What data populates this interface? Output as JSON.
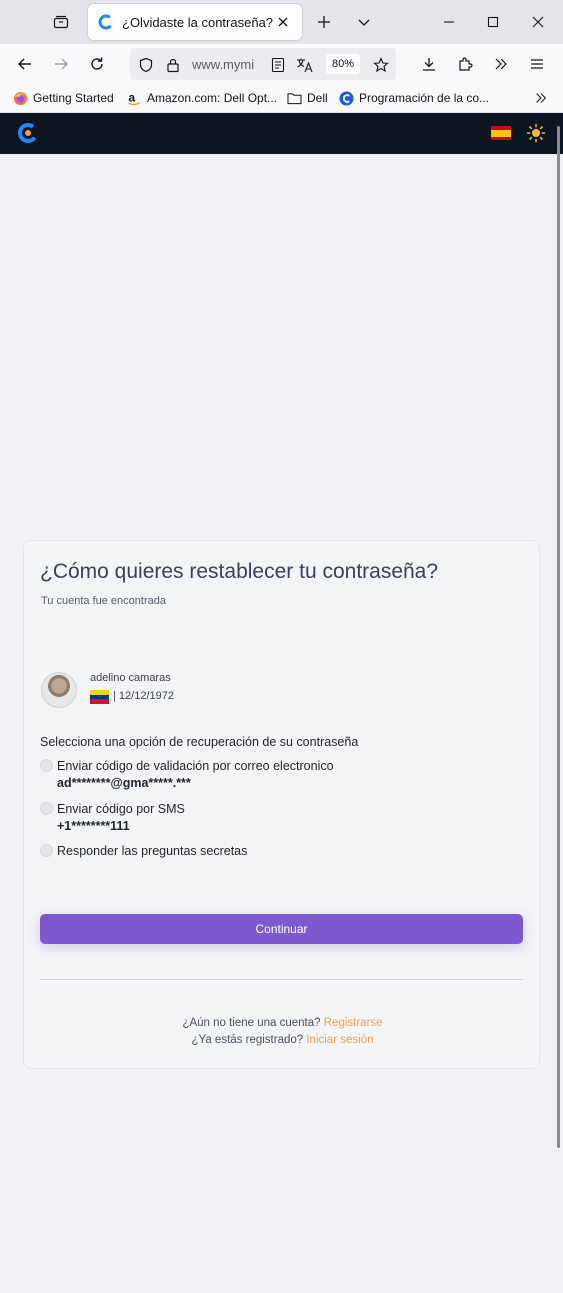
{
  "browser": {
    "tab_title": "¿Olvidaste la contraseña?",
    "url_text": "www.mymi",
    "zoom": "80%",
    "bookmarks": [
      {
        "label": "Getting Started",
        "icon": "firefox-icon"
      },
      {
        "label": "Amazon.com: Dell Opt...",
        "icon": "amazon-icon"
      },
      {
        "label": "Dell",
        "icon": "folder-icon"
      },
      {
        "label": "Programación de la co...",
        "icon": "site-c-icon"
      }
    ]
  },
  "site": {
    "brand_color": "#1e88ff",
    "header_bg": "#0d1523"
  },
  "card": {
    "title": "¿Cómo quieres restablecer tu contraseña?",
    "subtitle": "Tu cuenta fue encontrada",
    "user": {
      "name": "adelino camaras",
      "date": "| 12/12/1972"
    },
    "options_heading": "Selecciona una opción de recuperación de su contraseña",
    "options": [
      {
        "label": "Enviar código de validación por correo electronico",
        "detail": "ad********@gma*****.***"
      },
      {
        "label": "Enviar código por SMS",
        "detail": "+1********111"
      },
      {
        "label": "Responder las preguntas secretas",
        "detail": ""
      }
    ],
    "continue_label": "Continuar",
    "accent_color": "#7e5ad0",
    "footer": {
      "no_account_text": "¿Aún no tiene una cuenta?",
      "register_link": "Registrarse",
      "registered_text": "¿Ya estás registrado?",
      "login_link": "Iniciar sesión"
    }
  }
}
